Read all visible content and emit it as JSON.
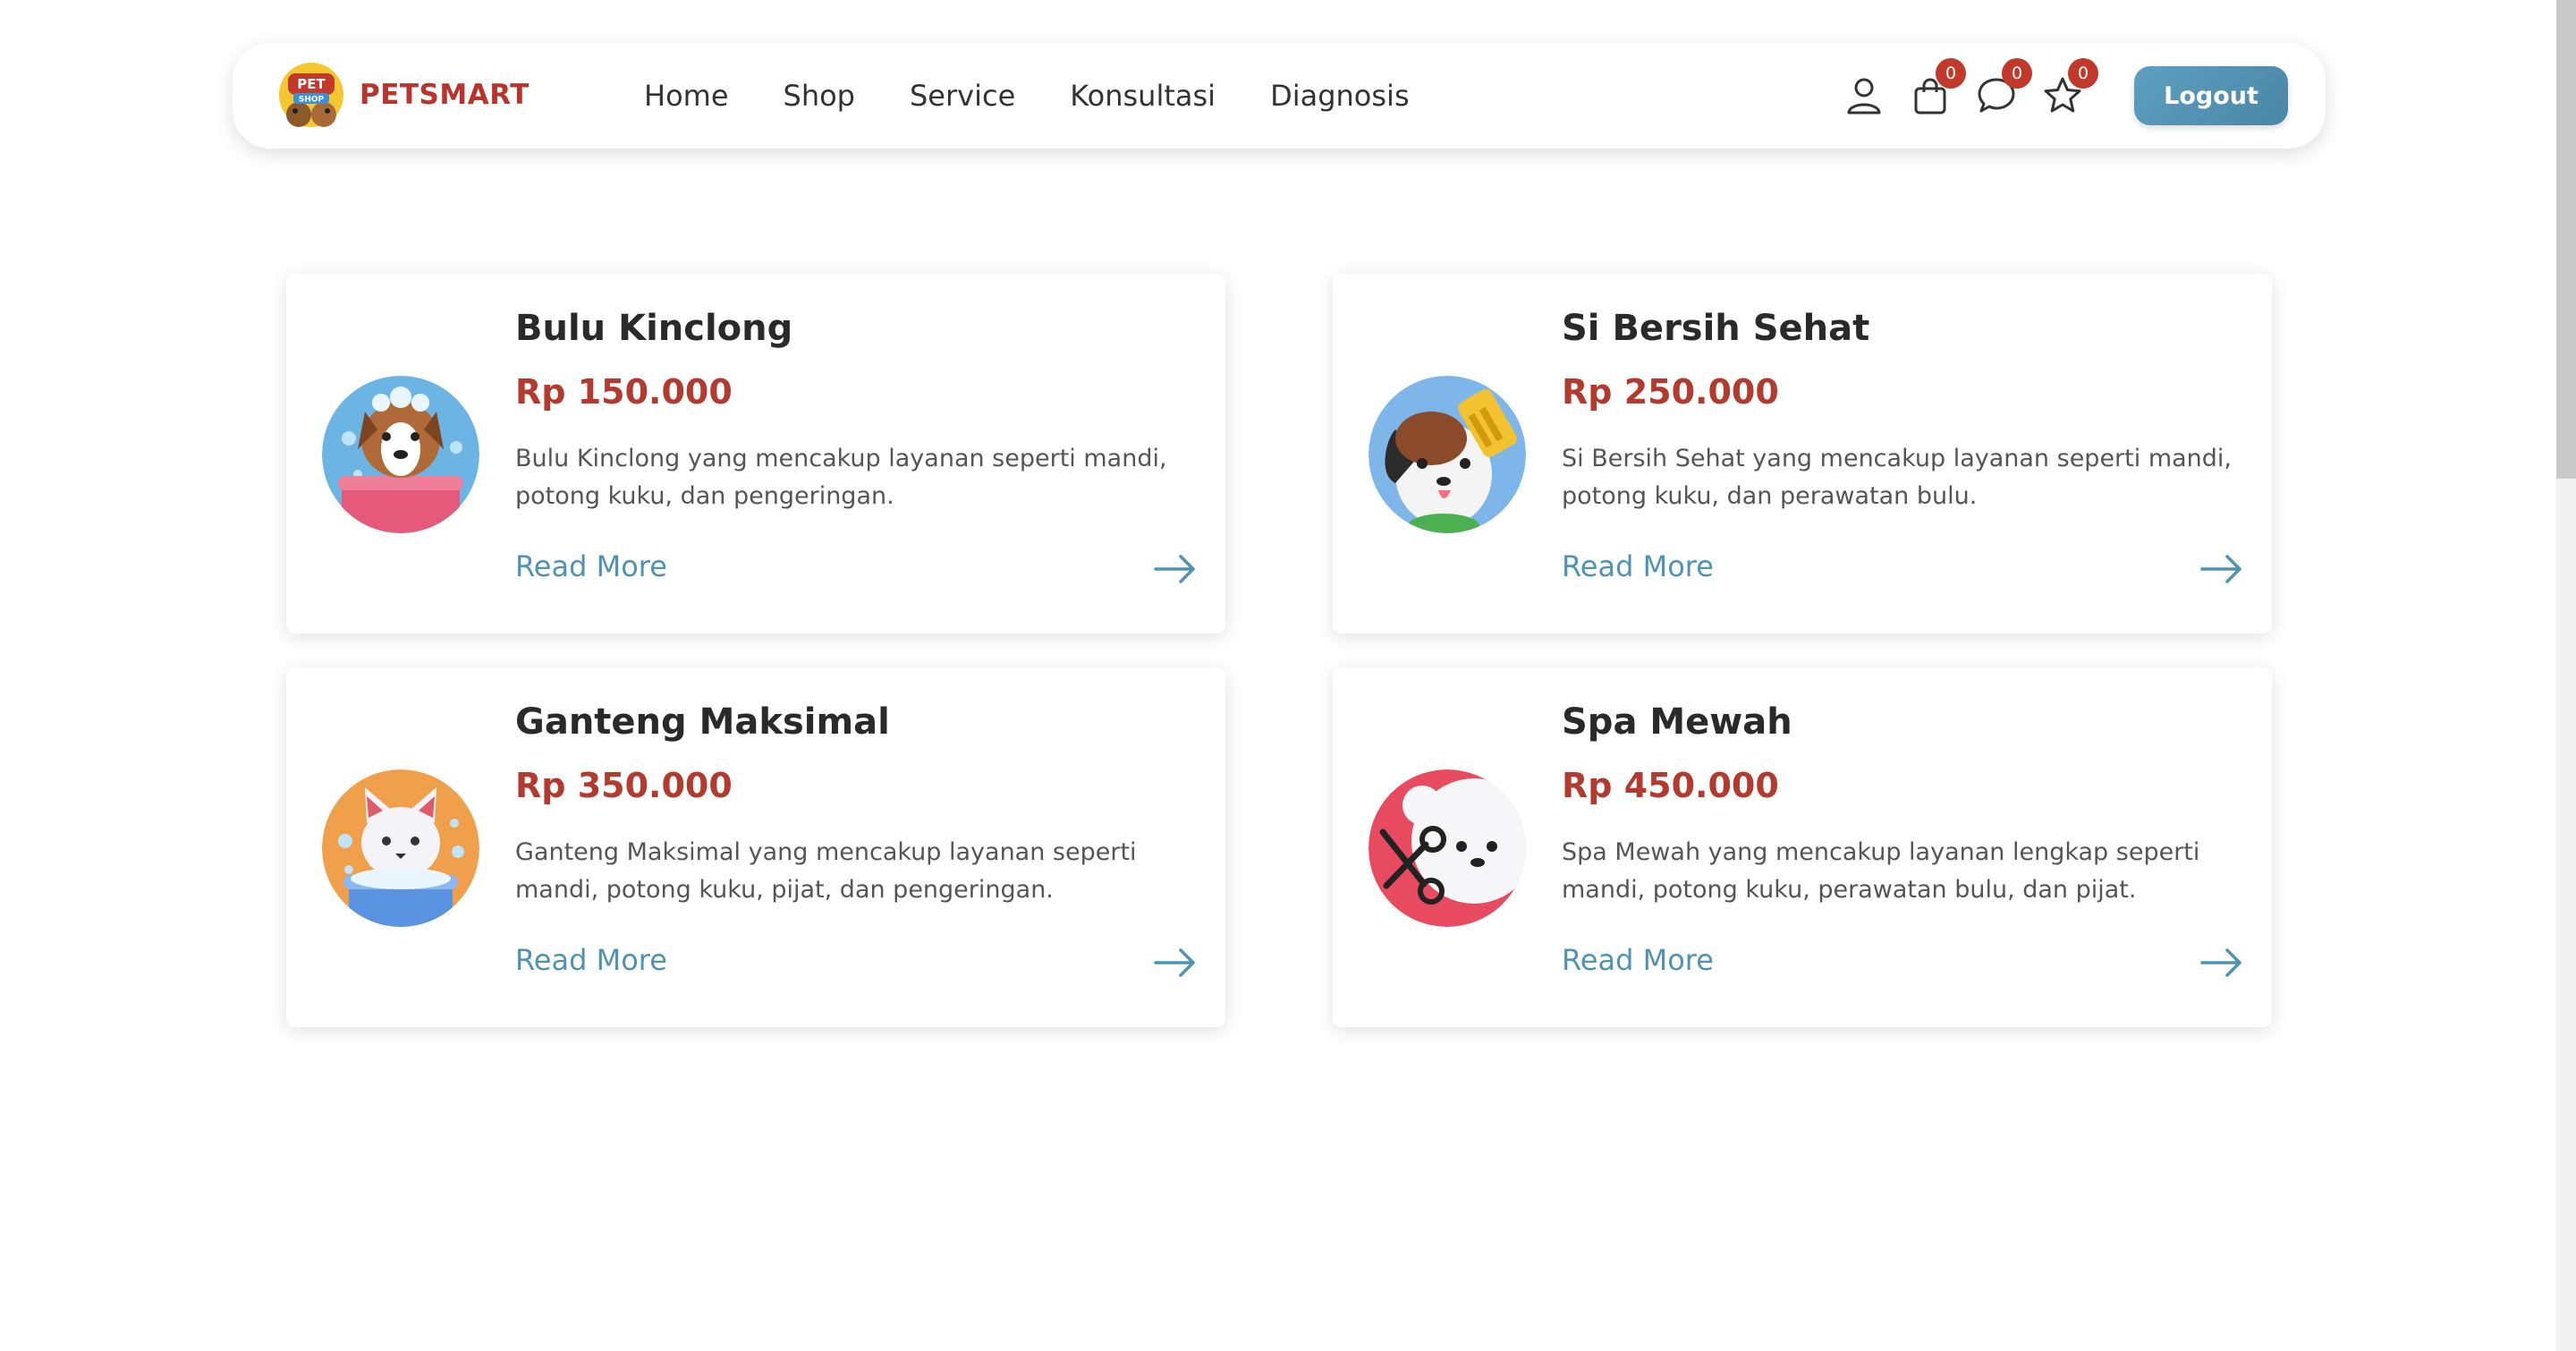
{
  "brand": {
    "name": "PETSMART",
    "logo_top": "PET",
    "logo_bottom": "SHOP"
  },
  "nav": {
    "links": [
      "Home",
      "Shop",
      "Service",
      "Konsultasi",
      "Diagnosis"
    ]
  },
  "header_actions": {
    "cart_count": "0",
    "chat_count": "0",
    "wishlist_count": "0",
    "logout_label": "Logout"
  },
  "colors": {
    "brand": "#b8342c",
    "price": "#b23a2e",
    "link": "#4f92b3",
    "button": "#5e9fc0",
    "badge": "#c0392b"
  },
  "services": [
    {
      "title": "Bulu Kinclong",
      "price": "Rp 150.000",
      "description": "Bulu Kinclong yang mencakup layanan seperti mandi, potong kuku, dan pengeringan.",
      "read_more": "Read More",
      "icon": "dog-bath-icon"
    },
    {
      "title": "Si Bersih Sehat",
      "price": "Rp 250.000",
      "description": "Si Bersih Sehat yang mencakup layanan seperti mandi, potong kuku, dan perawatan bulu.",
      "read_more": "Read More",
      "icon": "dog-brush-icon"
    },
    {
      "title": "Ganteng Maksimal",
      "price": "Rp 350.000",
      "description": "Ganteng Maksimal yang mencakup layanan seperti mandi, potong kuku, pijat, dan pengeringan.",
      "read_more": "Read More",
      "icon": "cat-bath-icon"
    },
    {
      "title": "Spa Mewah",
      "price": "Rp 450.000",
      "description": "Spa Mewah yang mencakup layanan lengkap seperti mandi, potong kuku, perawatan bulu, dan pijat.",
      "read_more": "Read More",
      "icon": "poodle-scissors-icon"
    }
  ]
}
